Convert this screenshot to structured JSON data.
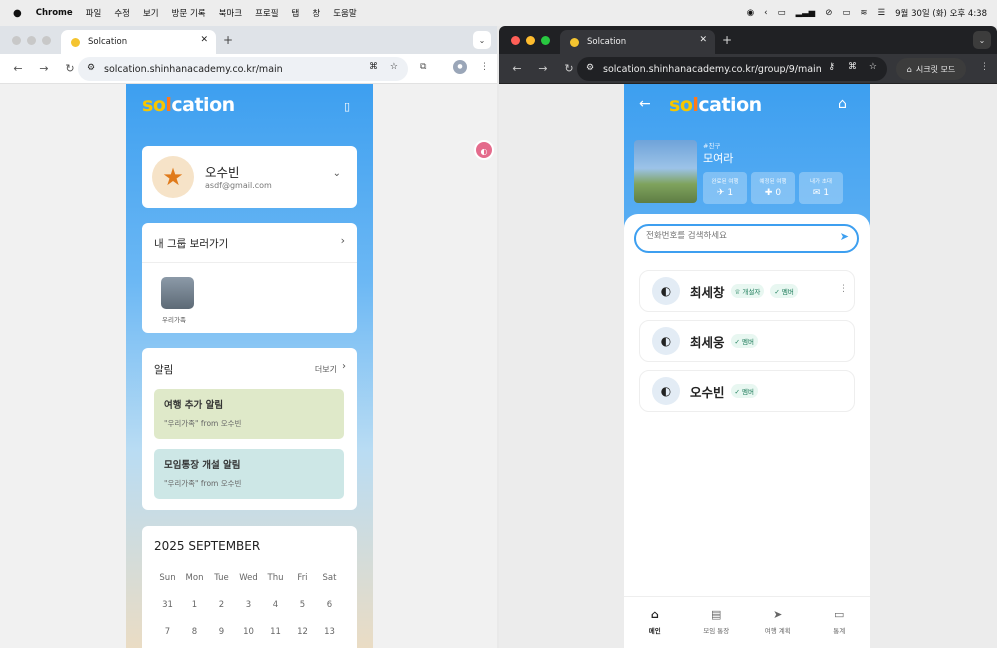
{
  "menubar": {
    "app": "Chrome",
    "items": [
      "파일",
      "수정",
      "보기",
      "방문 기록",
      "북마크",
      "프로필",
      "탭",
      "창",
      "도움말"
    ],
    "clock": "9월 30일 (화) 오후 4:38"
  },
  "left": {
    "tab_title": "Solcation",
    "url": "solcation.shinhanacademy.co.kr/main",
    "logo": {
      "s": "s",
      "o": "o",
      "l": "l",
      "rest": "cation"
    },
    "profile": {
      "name": "오수빈",
      "email": "asdf@gmail.com"
    },
    "groups": {
      "title": "내 그룹 보러가기",
      "items": [
        {
          "name": "우리가족"
        }
      ]
    },
    "alerts": {
      "title": "알림",
      "more": "더보기",
      "items": [
        {
          "title": "여행 추가 알림",
          "sub": "\"우리가족\" from 오수빈",
          "color": "#dfe9c9"
        },
        {
          "title": "모임통장 개설 알림",
          "sub": "\"우리가족\" from 오수빈",
          "color": "#cde7e6"
        }
      ]
    },
    "calendar": {
      "title": "2025 SEPTEMBER",
      "days": [
        "Sun",
        "Mon",
        "Tue",
        "Wed",
        "Thu",
        "Fri",
        "Sat"
      ],
      "rows": [
        [
          "31",
          "1",
          "2",
          "3",
          "4",
          "5",
          "6"
        ],
        [
          "7",
          "8",
          "9",
          "10",
          "11",
          "12",
          "13"
        ]
      ]
    }
  },
  "right": {
    "tab_title": "Solcation",
    "url": "solcation.shinhanacademy.co.kr/group/9/main",
    "secret": "시크릿 모드",
    "group": {
      "tag": "#친구",
      "name": "모여라"
    },
    "stats": [
      {
        "label": "완료된 여행",
        "value": "1",
        "icon": "✈"
      },
      {
        "label": "예정된 여행",
        "value": "0",
        "icon": "✚"
      },
      {
        "label": "내가 초대",
        "value": "1",
        "icon": "✉"
      }
    ],
    "search_placeholder": "전화번호를 검색하세요",
    "members": [
      {
        "name": "최세창",
        "badges": [
          "개설자",
          "멤버"
        ]
      },
      {
        "name": "최세웅",
        "badges": [
          "멤버"
        ]
      },
      {
        "name": "오수빈",
        "badges": [
          "멤버"
        ]
      }
    ],
    "bottom_nav": [
      {
        "label": "메인",
        "icon": "⌂"
      },
      {
        "label": "모임 통장",
        "icon": "▤"
      },
      {
        "label": "여행 계획",
        "icon": "➤"
      },
      {
        "label": "통계",
        "icon": "▭"
      }
    ]
  },
  "colors": {
    "primary": "#3d9ff0",
    "accent": "#f7c600"
  }
}
